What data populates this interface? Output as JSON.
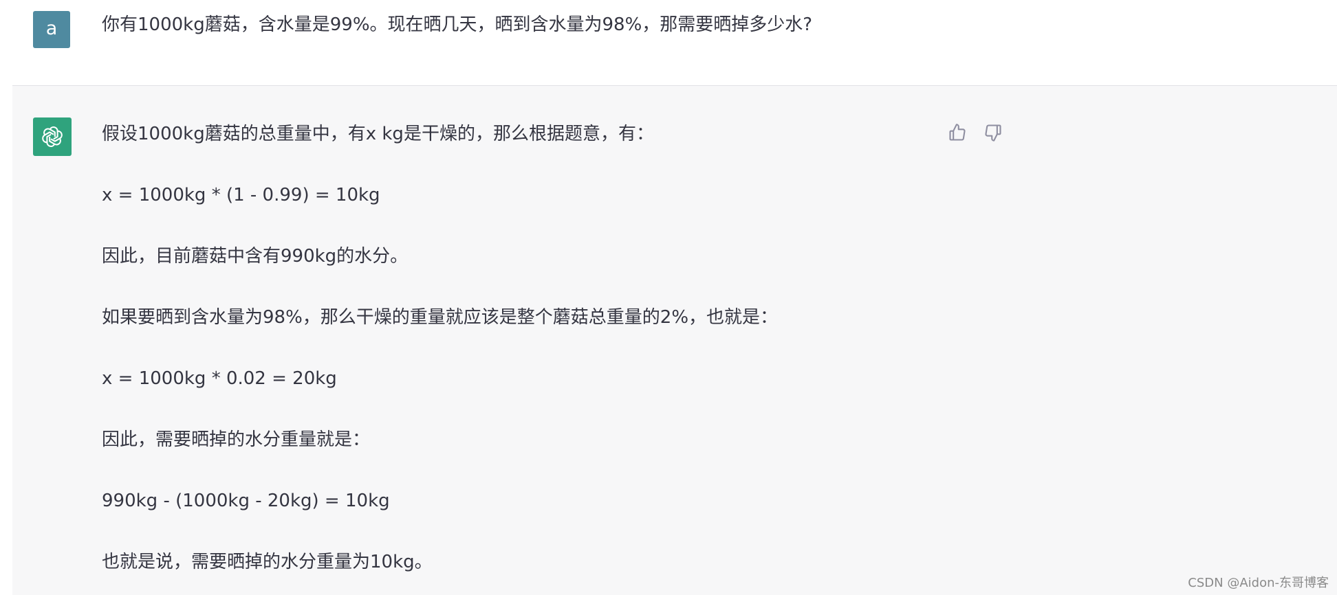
{
  "user": {
    "avatar_letter": "a",
    "message": "你有1000kg蘑菇，含水量是99%。现在晒几天，晒到含水量为98%，那需要晒掉多少水?"
  },
  "assistant": {
    "avatar_icon": "openai-logo-icon",
    "paragraphs": [
      "假设1000kg蘑菇的总重量中，有x kg是干燥的，那么根据题意，有：",
      "x = 1000kg * (1 - 0.99) = 10kg",
      "因此，目前蘑菇中含有990kg的水分。",
      "如果要晒到含水量为98%，那么干燥的重量就应该是整个蘑菇总重量的2%，也就是：",
      "x = 1000kg * 0.02 = 20kg",
      "因此，需要晒掉的水分重量就是：",
      "990kg - (1000kg - 20kg) = 10kg",
      "也就是说，需要晒掉的水分重量为10kg。"
    ],
    "feedback": {
      "thumbs_up_icon": "thumbs-up-icon",
      "thumbs_down_icon": "thumbs-down-icon"
    }
  },
  "watermark": "CSDN @Aidon-东哥博客",
  "colors": {
    "user_avatar": "#4f8aa0",
    "assistant_avatar": "#2fa37d",
    "assistant_row_bg": "#f7f7f8",
    "text": "#343541"
  }
}
